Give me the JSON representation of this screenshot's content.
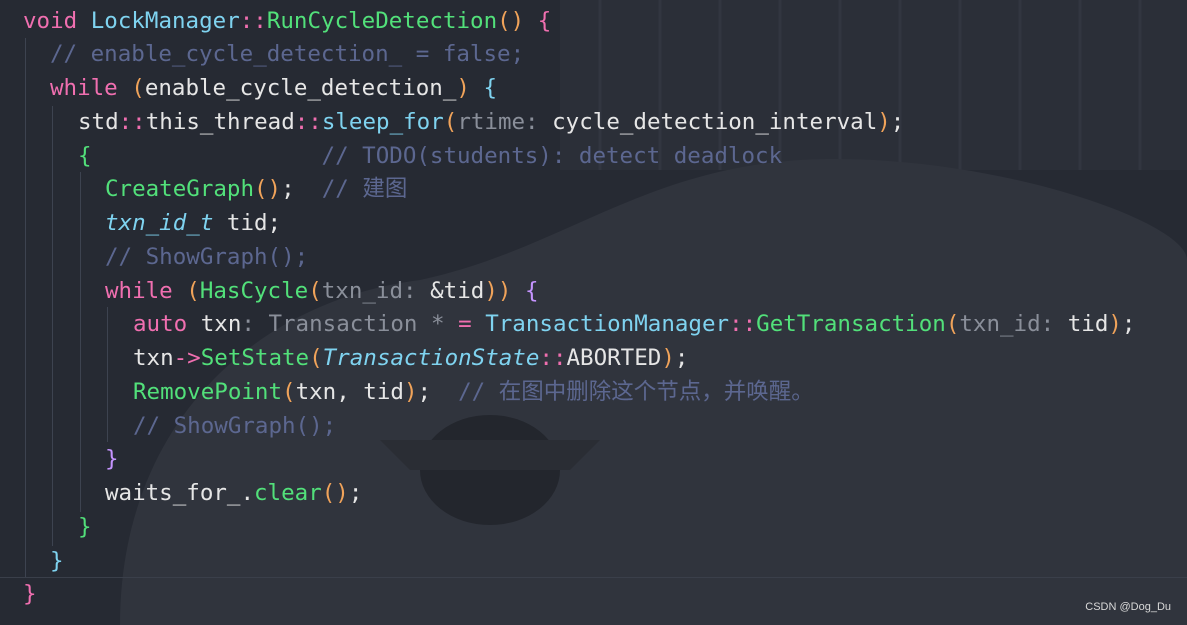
{
  "code": {
    "l1": {
      "kw": "void",
      "cls": "LockManager",
      "op": "::",
      "fn": "RunCycleDetection",
      "p": "()",
      "br": "{"
    },
    "l2": {
      "comment": "// enable_cycle_detection_ = false;"
    },
    "l3": {
      "kw": "while",
      "p1": "(",
      "plain": "enable_cycle_detection_",
      "p2": ")",
      "br": "{"
    },
    "l4": {
      "ns": "std",
      "op1": "::",
      "obj": "this_thread",
      "op2": "::",
      "fn": "sleep_for",
      "p1": "(",
      "hint": "rtime:",
      "arg": "cycle_detection_interval",
      "p2": ")",
      "semi": ";"
    },
    "l5": {
      "br": "{",
      "comment": "// TODO(students): detect deadlock"
    },
    "l6": {
      "fn": "CreateGraph",
      "p": "()",
      "semi": ";",
      "comment": "// 建图"
    },
    "l7": {
      "type": "txn_id_t",
      "rest": " tid;"
    },
    "l8": {
      "comment": "// ShowGraph();"
    },
    "l9": {
      "kw": "while",
      "p1": "(",
      "fn": "HasCycle",
      "p2": "(",
      "hint": "txn_id:",
      "arg": "&tid",
      "p3": ")",
      "p4": ")",
      "br": "{"
    },
    "l10": {
      "kw": "auto",
      "plain": " txn",
      "hint": ": Transaction * ",
      "eq": "=",
      "cls": "TransactionManager",
      "op": "::",
      "fn": "GetTransaction",
      "p1": "(",
      "hint2": "txn_id:",
      "arg": "tid",
      "p2": ")",
      "semi": ";"
    },
    "l11": {
      "plain": "txn",
      "op": "->",
      "fn": "SetState",
      "p1": "(",
      "type": "TransactionState",
      "op2": "::",
      "arg": "ABORTED",
      "p2": ")",
      "semi": ";"
    },
    "l12": {
      "fn": "RemovePoint",
      "p1": "(",
      "arg": "txn, tid",
      "p2": ")",
      "semi": ";",
      "comment": "// 在图中删除这个节点，并唤醒。"
    },
    "l13": {
      "comment": "// ShowGraph();"
    },
    "l14": {
      "br": "}"
    },
    "l15": {
      "obj": "waits_for_",
      "dot": ".",
      "fn": "clear",
      "p": "()",
      "semi": ";"
    },
    "l16": {
      "br": "}"
    },
    "l17": {
      "br": "}"
    },
    "l18": {
      "br": "}"
    }
  },
  "watermark": "CSDN @Dog_Du"
}
